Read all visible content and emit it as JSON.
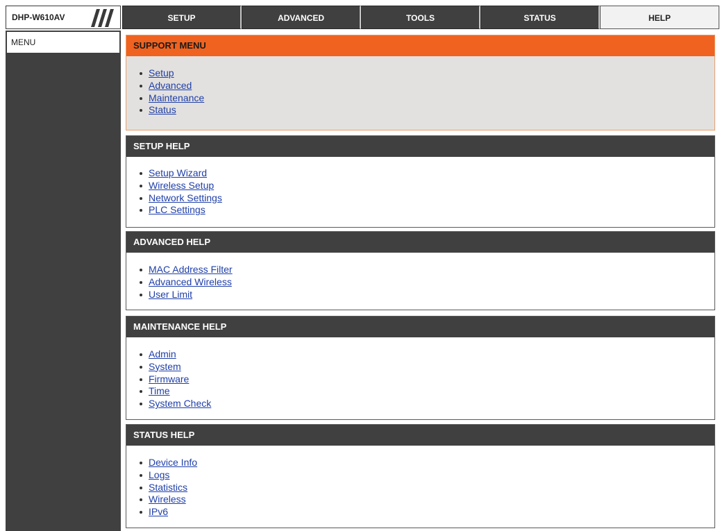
{
  "header": {
    "model": "DHP-W610AV",
    "tabs": [
      {
        "label": "SETUP"
      },
      {
        "label": "ADVANCED"
      },
      {
        "label": "TOOLS"
      },
      {
        "label": "STATUS"
      },
      {
        "label": "HELP",
        "active": true
      }
    ]
  },
  "sidebar": {
    "items": [
      {
        "label": "MENU"
      }
    ]
  },
  "sections": {
    "support": {
      "title": "SUPPORT MENU",
      "links": [
        "Setup",
        "Advanced",
        "Maintenance",
        "Status"
      ]
    },
    "setup": {
      "title": "SETUP HELP",
      "links": [
        "Setup Wizard",
        "Wireless Setup",
        "Network Settings",
        "PLC Settings"
      ]
    },
    "advanced": {
      "title": "ADVANCED HELP",
      "links": [
        "MAC Address Filter",
        "Advanced Wireless",
        "User Limit"
      ]
    },
    "maintenance": {
      "title": "MAINTENANCE HELP",
      "links": [
        "Admin",
        "System",
        "Firmware",
        "Time",
        "System Check"
      ]
    },
    "status": {
      "title": "STATUS HELP",
      "links": [
        "Device Info",
        "Logs",
        "Statistics",
        "Wireless",
        "IPv6"
      ]
    }
  },
  "colors": {
    "tab_background": "#404040",
    "support_header": "#f0621f",
    "support_panel": "#e3e1df",
    "section_header": "#404040",
    "link": "#1f3fa8"
  }
}
